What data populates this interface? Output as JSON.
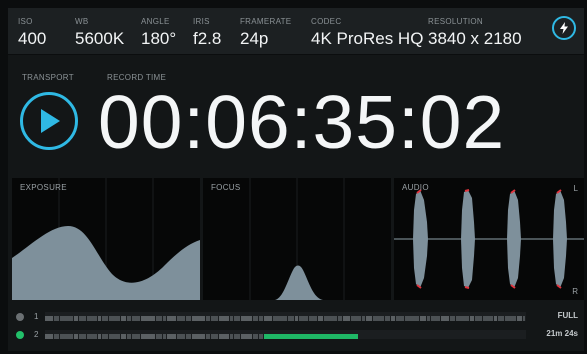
{
  "status_bar": {
    "params": [
      {
        "label": "ISO",
        "value": "400"
      },
      {
        "label": "WB",
        "value": "5600K"
      },
      {
        "label": "ANGLE",
        "value": "180°"
      },
      {
        "label": "IRIS",
        "value": "f2.8"
      },
      {
        "label": "FRAMERATE",
        "value": "24p"
      },
      {
        "label": "CODEC",
        "value": "4K ProRes HQ"
      },
      {
        "label": "RESOLUTION",
        "value": "3840 x 2180"
      }
    ],
    "power_icon": "lightning-bolt-icon"
  },
  "transport": {
    "label": "TRANSPORT",
    "play_icon": "play-icon",
    "record_time_label": "RECORD TIME",
    "timecode": "00:06:35:02"
  },
  "scopes": {
    "exposure": {
      "label": "EXPOSURE"
    },
    "focus": {
      "label": "FOCUS"
    },
    "audio": {
      "label": "AUDIO",
      "left_channel": "L",
      "right_channel": "R"
    }
  },
  "storage": [
    {
      "slot": "1",
      "status": "FULL",
      "indicator": "#6b7073",
      "fill_fraction": 1.0,
      "active": false
    },
    {
      "slot": "2",
      "status": "21m 24s",
      "indicator": "#22c06a",
      "fill_fraction": 0.65,
      "active": true
    }
  ],
  "colors": {
    "accent": "#2fb9e4",
    "recording_green": "#1fb866",
    "audio_peak": "#e0343e"
  }
}
